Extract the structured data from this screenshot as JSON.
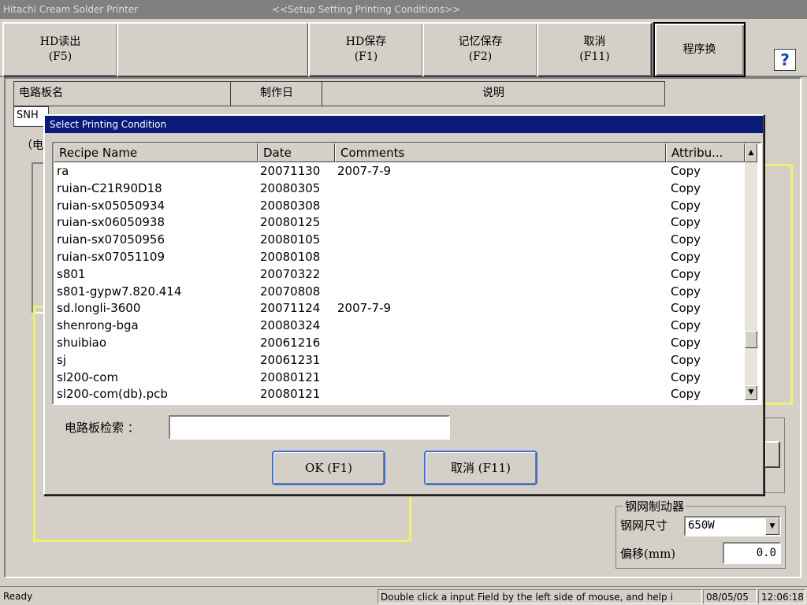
{
  "window": {
    "app_title": "Hitachi Cream Solder Printer",
    "screen_title": "<<Setup Setting Printing Conditions>>"
  },
  "toolbar": {
    "hd_read": [
      "HD读出",
      "(F5)"
    ],
    "hd_save": [
      "HD保存",
      "(F1)"
    ],
    "memory_save": [
      "记忆保存",
      "(F2)"
    ],
    "cancel": [
      "取消",
      "(F11)"
    ],
    "program_switch": "程序换",
    "help": "?"
  },
  "form": {
    "board_name_header": "电路板名",
    "created_date_header": "制作日",
    "description_header": "说明",
    "board_name_value": "SNH",
    "group_label_partial": "（电",
    "stencil_group_label": "钢网制动器",
    "stencil_size_label": "钢网尺寸",
    "stencil_size_value": "650W",
    "offset_label": "偏移(mm)",
    "offset_value": "0.0"
  },
  "dialog": {
    "title": "Select Printing Condition",
    "columns": [
      "Recipe Name",
      "Date",
      "Comments",
      "Attribu..."
    ],
    "rows": [
      [
        "ra",
        "20071130",
        "2007-7-9",
        "Copy"
      ],
      [
        "ruian-C21R90D18",
        "20080305",
        "",
        "Copy"
      ],
      [
        "ruian-sx05050934",
        "20080308",
        "",
        "Copy"
      ],
      [
        "ruian-sx06050938",
        "20080125",
        "",
        "Copy"
      ],
      [
        "ruian-sx07050956",
        "20080105",
        "",
        "Copy"
      ],
      [
        "ruian-sx07051109",
        "20080108",
        "",
        "Copy"
      ],
      [
        "s801",
        "20070322",
        "",
        "Copy"
      ],
      [
        "s801-gypw7.820.414",
        "20070808",
        "",
        "Copy"
      ],
      [
        "sd.longli-3600",
        "20071124",
        "2007-7-9",
        "Copy"
      ],
      [
        "shenrong-bga",
        "20080324",
        "",
        "Copy"
      ],
      [
        "shuibiao",
        "20061216",
        "",
        "Copy"
      ],
      [
        "sj",
        "20061231",
        "",
        "Copy"
      ],
      [
        "sl200-com",
        "20080121",
        "",
        "Copy"
      ],
      [
        "sl200-com(db).pcb",
        "20080121",
        "",
        "Copy"
      ]
    ],
    "search_label": "电路板检索 ：",
    "search_value": "",
    "ok_label": "OK (F1)",
    "cancel_label": "取消 (F11)"
  },
  "statusbar": {
    "status": "Ready",
    "hint": "Double click a input Field by the left side of mouse, and help i",
    "date": "08/05/05",
    "time": "12:06:18"
  },
  "colors": {
    "dialog_titlebar": "#0a1a78",
    "dialog_button_focus": "#3a6fd8",
    "highlight_frame": "#f0f070",
    "help_icon": "#1a3fb5"
  }
}
